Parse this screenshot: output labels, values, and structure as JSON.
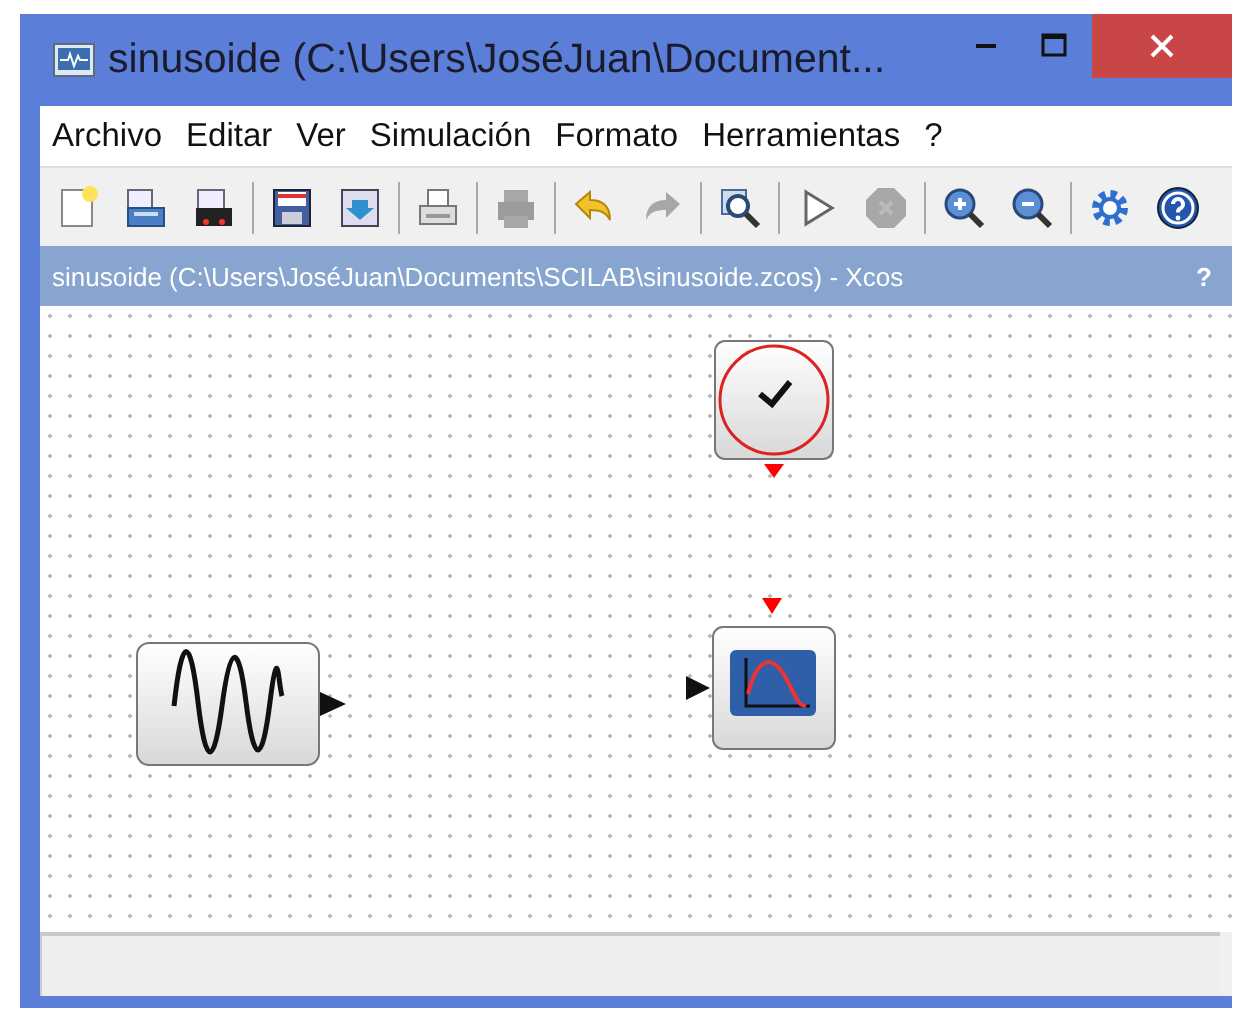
{
  "window": {
    "title": "sinusoide (C:\\Users\\JoséJuan\\Document..."
  },
  "menu": [
    "Archivo",
    "Editar",
    "Ver",
    "Simulación",
    "Formato",
    "Herramientas",
    "?"
  ],
  "toolbar": [
    {
      "kind": "new",
      "disabled": false
    },
    {
      "kind": "open",
      "disabled": false
    },
    {
      "kind": "open-file",
      "disabled": false
    },
    {
      "kind": "sep"
    },
    {
      "kind": "save",
      "disabled": false
    },
    {
      "kind": "save-as",
      "disabled": false
    },
    {
      "kind": "sep"
    },
    {
      "kind": "export",
      "disabled": false
    },
    {
      "kind": "sep"
    },
    {
      "kind": "print",
      "disabled": true
    },
    {
      "kind": "sep"
    },
    {
      "kind": "undo",
      "disabled": false
    },
    {
      "kind": "redo",
      "disabled": true
    },
    {
      "kind": "sep"
    },
    {
      "kind": "zoom-fit",
      "disabled": false
    },
    {
      "kind": "sep"
    },
    {
      "kind": "start",
      "disabled": false
    },
    {
      "kind": "stop",
      "disabled": true
    },
    {
      "kind": "sep"
    },
    {
      "kind": "zoom-in",
      "disabled": false
    },
    {
      "kind": "zoom-out",
      "disabled": false
    },
    {
      "kind": "sep"
    },
    {
      "kind": "settings",
      "disabled": false
    },
    {
      "kind": "help",
      "disabled": false
    }
  ],
  "document": {
    "title": "sinusoide (C:\\Users\\JoséJuan\\Documents\\SCILAB\\sinusoide.zcos) - Xcos",
    "help": "?"
  },
  "diagram": {
    "blocks": [
      {
        "kind": "clock"
      },
      {
        "kind": "sine"
      },
      {
        "kind": "scope"
      }
    ]
  }
}
